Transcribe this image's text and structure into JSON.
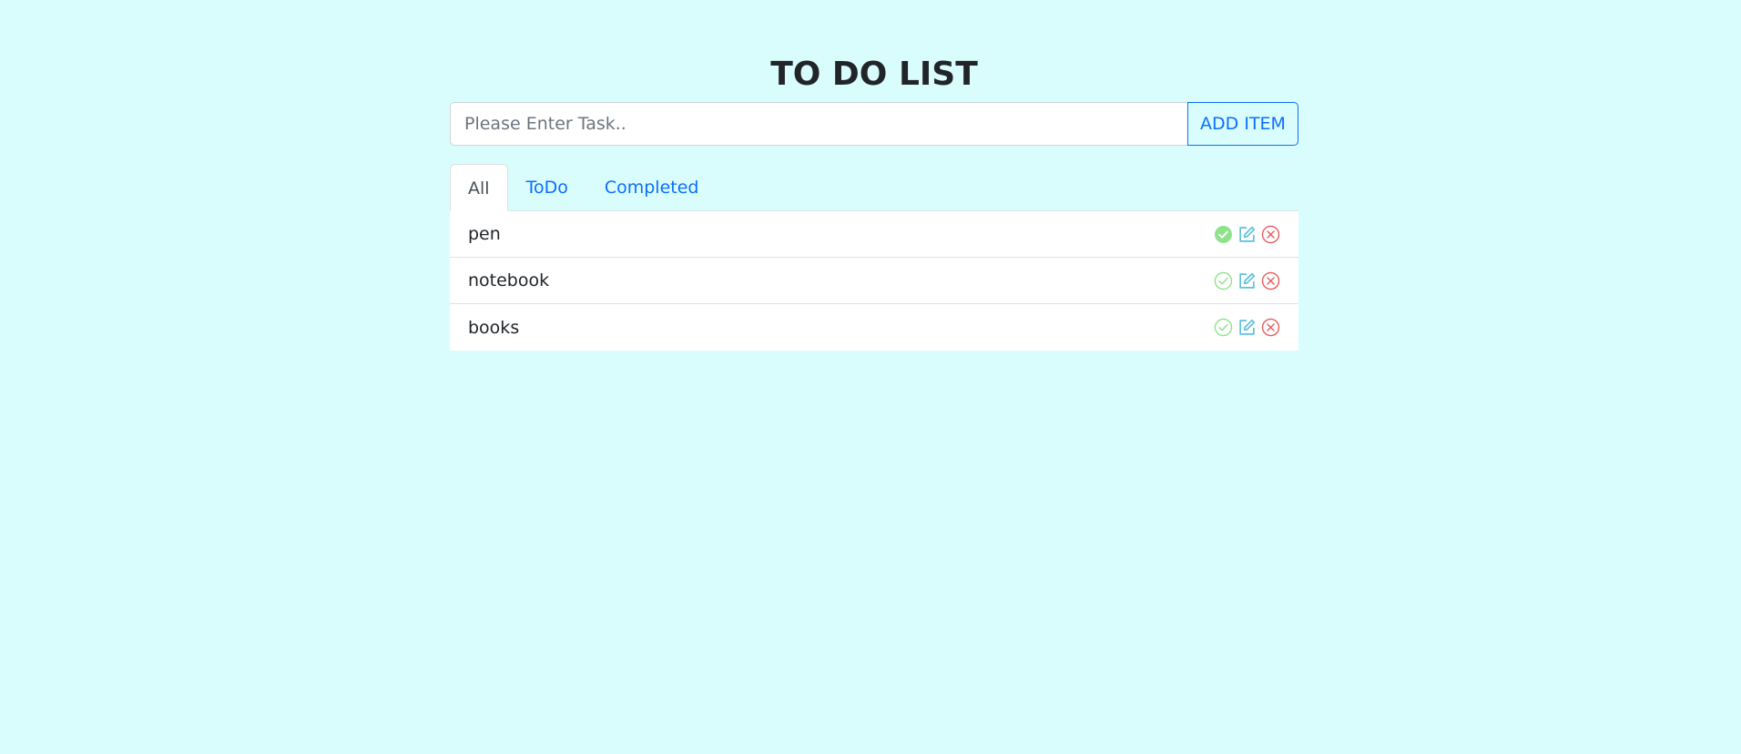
{
  "header": {
    "title": "TO DO LIST"
  },
  "input": {
    "placeholder": "Please Enter Task..",
    "value": "",
    "add_label": "ADD ITEM"
  },
  "tabs": [
    {
      "label": "All",
      "active": true
    },
    {
      "label": "ToDo",
      "active": false
    },
    {
      "label": "Completed",
      "active": false
    }
  ],
  "items": [
    {
      "text": "pen",
      "completed": true
    },
    {
      "text": "notebook",
      "completed": false
    },
    {
      "text": "books",
      "completed": false
    }
  ],
  "icons": {
    "complete": "check-circle-icon",
    "edit": "edit-icon",
    "delete": "x-circle-icon"
  },
  "colors": {
    "background": "#d9fdfc",
    "primary": "#0d6efd",
    "complete": "#8ee28a",
    "edit": "#5bc0de",
    "delete": "#e85b5b"
  }
}
